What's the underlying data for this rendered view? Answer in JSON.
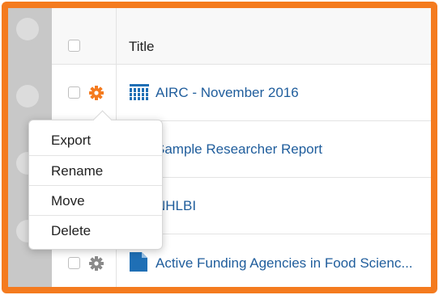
{
  "table": {
    "header": {
      "title_label": "Title"
    },
    "rows": [
      {
        "title": "AIRC - November 2016",
        "type_icon": "grid-report-icon",
        "gear_color": "#f47b1f"
      },
      {
        "title": "Sample Researcher Report"
      },
      {
        "title": "NHLBI"
      },
      {
        "title": "Active Funding Agencies in Food Scienc...",
        "type_icon": "document-icon",
        "gear_color": "#8a8a8a"
      }
    ]
  },
  "context_menu": {
    "items": [
      {
        "label": "Export"
      },
      {
        "label": "Rename"
      },
      {
        "label": "Move"
      },
      {
        "label": "Delete"
      }
    ]
  },
  "colors": {
    "accent": "#f47b1f",
    "link": "#1f5d9c",
    "icon_blue": "#1f6fb5"
  }
}
